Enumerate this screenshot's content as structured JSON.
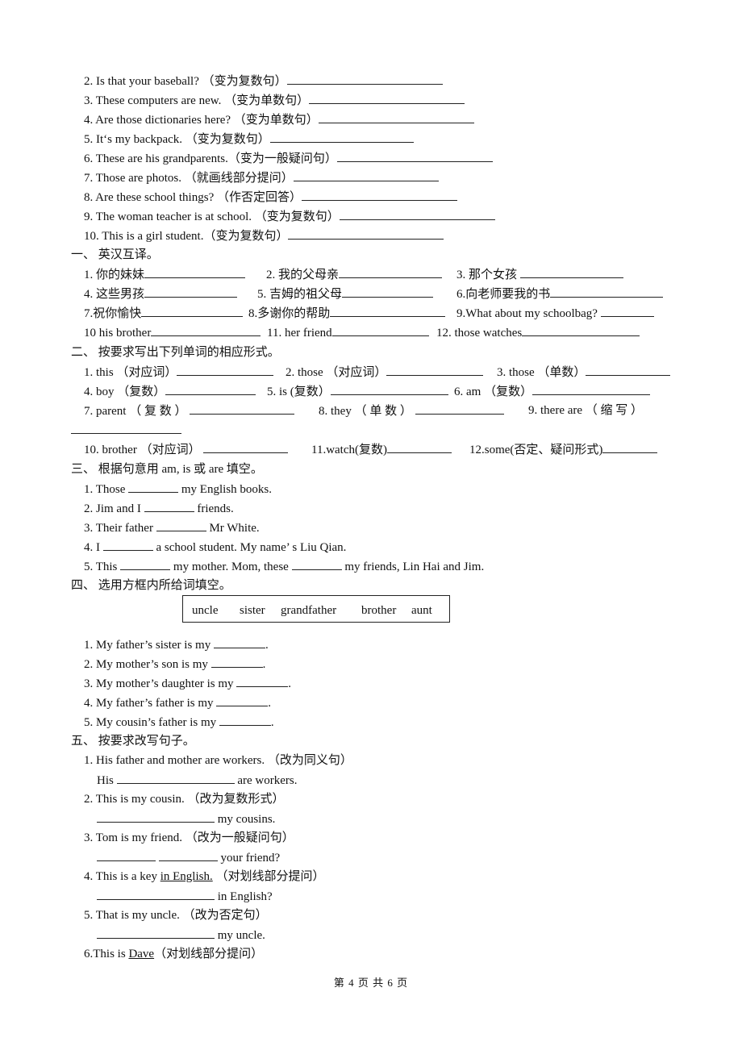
{
  "section0": {
    "items": [
      {
        "text": "2. Is that your baseball?  （变为复数句）"
      },
      {
        "text": "3. These computers are new.  （变为单数句）"
      },
      {
        "text": "4. Are those dictionaries here?  （变为单数句）"
      },
      {
        "text": "5. It‘s my backpack.  （变为复数句）"
      },
      {
        "text": "6. These are his grandparents.（变为一般疑问句）"
      },
      {
        "text": "7. Those are photos.  （就画线部分提问）"
      },
      {
        "text": "8. Are these school things?  （作否定回答）"
      },
      {
        "text": "9. The woman teacher is at school.  （变为复数句）"
      },
      {
        "text": "10. This is a girl student.（变为复数句）"
      }
    ]
  },
  "section1": {
    "title": "一、  英汉互译。",
    "rows": [
      [
        "1. 你的妹妹",
        "2. 我的父母亲",
        "3. 那个女孩 "
      ],
      [
        "4. 这些男孩",
        "5. 吉姆的祖父母",
        "6.向老师要我的书"
      ],
      [
        "7.祝你愉快",
        "8.多谢你的帮助",
        "9.What about my schoolbag? "
      ],
      [
        "10 his brother",
        "11. her friend",
        "12. those watches"
      ]
    ]
  },
  "section2": {
    "title": "二、  按要求写出下列单词的相应形式。",
    "rows": [
      [
        "1. this （对应词）",
        "2. those （对应词）",
        "3. those （单数）"
      ],
      [
        "4. boy （复数）",
        "5. is (复数）",
        "6. am （复数）"
      ],
      [
        "7.  parent  （ 复  数 ）",
        "8.  they  （ 单  数 ）",
        "9.  there  are  （ 缩  写 ）"
      ],
      [
        "10. brother （对应词）",
        "11.watch(复数)",
        "12.some(否定、疑问形式)"
      ]
    ]
  },
  "section3": {
    "title": "三、  根据句意用 am, is 或 are 填空。",
    "items": [
      {
        "before": "1. Those ",
        "after": " my English books."
      },
      {
        "before": "2. Jim and I ",
        "after": " friends."
      },
      {
        "before": "3. Their father ",
        "after": " Mr White."
      },
      {
        "before": "4. I ",
        "after": " a school student. My name’  s   Liu Qian."
      },
      {
        "before": "5. This ",
        "middle": " my mother. Mom, these ",
        "after": " my friends, Lin Hai and Jim."
      }
    ]
  },
  "section4": {
    "title": "四、  选用方框内所给词填空。",
    "words": [
      "uncle",
      "sister",
      "grandfather",
      "brother",
      "aunt"
    ],
    "items": [
      {
        "before": "1. My father’s sister is my ",
        "after": "."
      },
      {
        "before": "2. My mother’s son is my ",
        "after": "."
      },
      {
        "before": "3. My mother’s daughter is my ",
        "after": "."
      },
      {
        "before": "4. My father’s father is my ",
        "after": "."
      },
      {
        "before": "5. My cousin’s father is my ",
        "after": "."
      }
    ]
  },
  "section5": {
    "title": "五、  按要求改写句子。",
    "q1": {
      "text": "1. His father and mother are workers.  （改为同义句）",
      "ans_before": "His ",
      "ans_after": " are workers."
    },
    "q2": {
      "text": "2. This is my cousin.  （改为复数形式）",
      "ans_after": " my cousins."
    },
    "q3": {
      "text": "3. Tom is my friend.  （改为一般疑问句）",
      "ans_after": " your friend?"
    },
    "q4": {
      "before": "4. This is a key ",
      "underlined": "in English.",
      "after": "  （对划线部分提问）",
      "ans_after": " in English?"
    },
    "q5": {
      "text": "5. That is my uncle.  （改为否定句）",
      "ans_after": " my uncle."
    },
    "q6": {
      "before": "6.This is ",
      "underlined": "Dave",
      "after": "（对划线部分提问）"
    }
  },
  "footer": {
    "page_info": "第 4 页 共 6 页"
  }
}
